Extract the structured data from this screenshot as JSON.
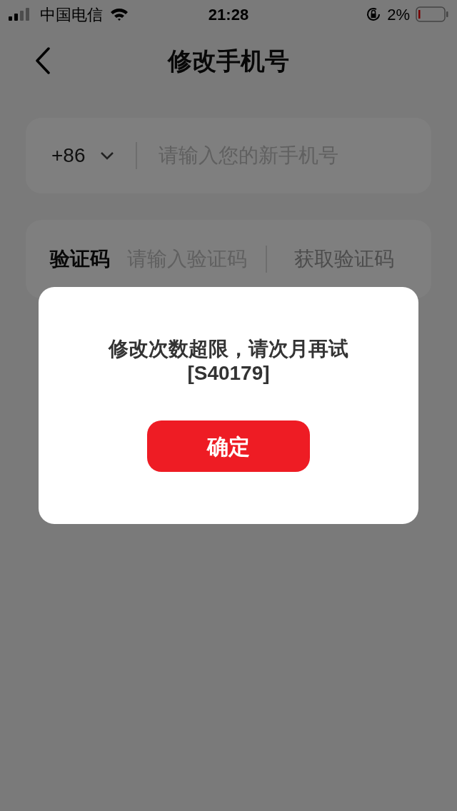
{
  "status_bar": {
    "carrier": "中国电信",
    "time": "21:28",
    "battery": "2%"
  },
  "nav": {
    "title": "修改手机号"
  },
  "phone": {
    "country_code": "+86",
    "placeholder": "请输入您的新手机号"
  },
  "code": {
    "label": "验证码",
    "placeholder": "请输入验证码",
    "action": "获取验证码"
  },
  "dialog": {
    "message": "修改次数超限，请次月再试",
    "code": "[S40179]",
    "button": "确定"
  }
}
